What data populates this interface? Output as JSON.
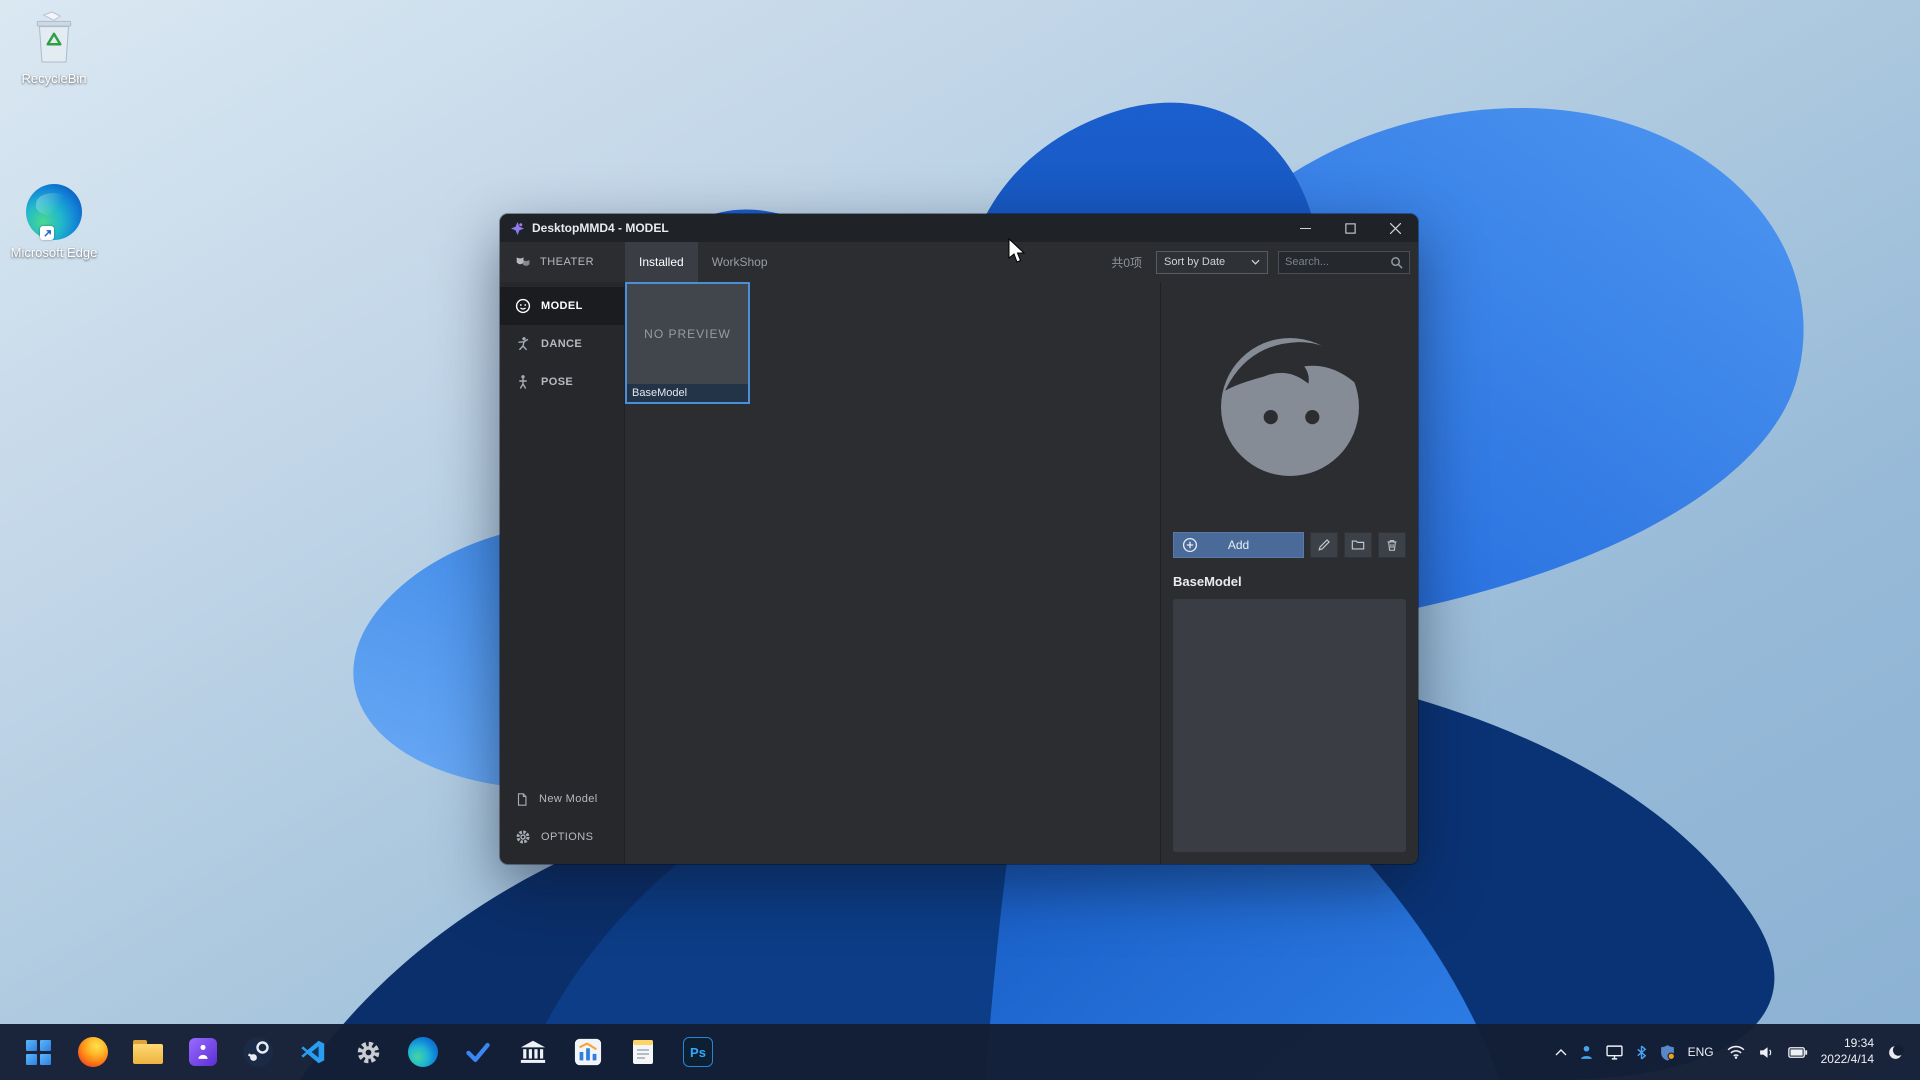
{
  "desktop": {
    "icons": [
      {
        "label": "RecycleBin"
      },
      {
        "label": "Microsoft Edge"
      }
    ]
  },
  "window": {
    "title": "DesktopMMD4 - MODEL",
    "toolbar": {
      "theater": "THEATER",
      "tabs": [
        {
          "label": "Installed"
        },
        {
          "label": "WorkShop"
        }
      ],
      "item_count": "共0项",
      "sort": "Sort by Date",
      "search_placeholder": "Search..."
    },
    "sidebar": {
      "items": [
        {
          "label": "MODEL"
        },
        {
          "label": "DANCE"
        },
        {
          "label": "POSE"
        }
      ],
      "footer": [
        {
          "label": "New Model"
        },
        {
          "label": "OPTIONS"
        }
      ]
    },
    "library": {
      "card": {
        "preview": "NO PREVIEW",
        "name": "BaseModel"
      }
    },
    "detail": {
      "add": "Add",
      "name": "BaseModel"
    }
  },
  "taskbar": {
    "apps": [
      "start",
      "firefox",
      "file-explorer",
      "desktopmmd",
      "steam",
      "vscode",
      "settings",
      "edge",
      "todo-check",
      "bank-app",
      "stats-app",
      "notepad",
      "photoshop"
    ],
    "photoshop_label": "Ps",
    "tray": {
      "language": "ENG",
      "time": "19:34",
      "date": "2022/4/14"
    }
  },
  "colors": {
    "selection_blue": "#4a90d9",
    "add_button_blue": "#4a6b9a",
    "window_bg": "#2b2d31",
    "taskbar_bg": "#141e34"
  }
}
